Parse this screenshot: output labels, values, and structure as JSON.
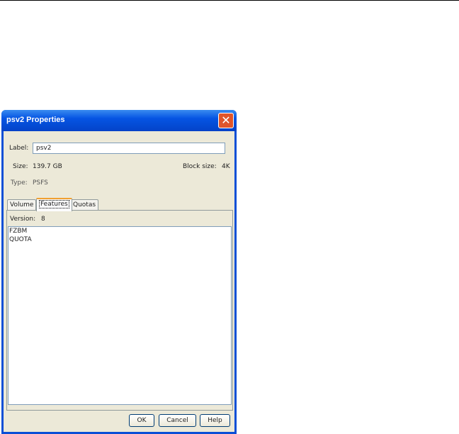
{
  "dialog": {
    "title": "psv2 Properties",
    "label_caption": "Label:",
    "label_value": "psv2",
    "size_caption": "Size:",
    "size_value": "139.7 GB",
    "block_caption": "Block size:",
    "block_value": "4K",
    "type_caption": "Type:",
    "type_value": "PSFS",
    "tabs": [
      {
        "label": "Volume"
      },
      {
        "label": "Features"
      },
      {
        "label": "Quotas"
      }
    ],
    "version_caption": "Version:",
    "version_value": "8",
    "features": [
      "FZBM",
      "QUOTA"
    ],
    "buttons": {
      "ok": "OK",
      "cancel": "Cancel",
      "help": "Help"
    }
  }
}
